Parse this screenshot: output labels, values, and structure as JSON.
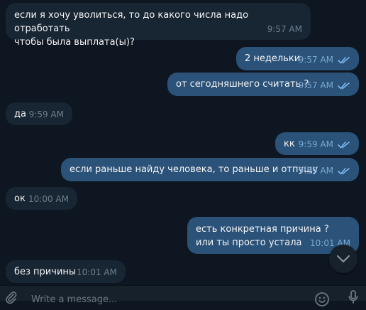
{
  "messages": [
    {
      "text": "если я хочу уволиться, то до какого числа надо отработать\nчтобы была выплата(ы)?",
      "time": "9:57 AM"
    },
    {
      "text": "2 недельки",
      "time": "9:57 AM"
    },
    {
      "text": "от сегодняшнего считать ?",
      "time": "9:57 AM"
    },
    {
      "text": "да",
      "time": "9:59 AM"
    },
    {
      "text": "кк",
      "time": "9:59 AM"
    },
    {
      "text": "если раньше найду человека, то раньше и отпущу",
      "time": "9:59 AM"
    },
    {
      "text": "ок",
      "time": "10:00 AM"
    },
    {
      "text": "есть конкретная причина ?\nили ты просто устала",
      "time": "10:01 AM"
    },
    {
      "text": "без причины",
      "time": "10:01 AM"
    }
  ],
  "composer": {
    "placeholder": "Write a message..."
  },
  "colors": {
    "background": "#0e1621",
    "incoming_bubble": "#182533",
    "outgoing_bubble": "#2b5278",
    "read_check": "#7eb8f0"
  },
  "icons": {
    "read": "double-check-icon",
    "scroll": "chevron-down-icon",
    "attach": "paperclip-icon",
    "emoji": "smile-icon",
    "mic": "microphone-icon"
  }
}
